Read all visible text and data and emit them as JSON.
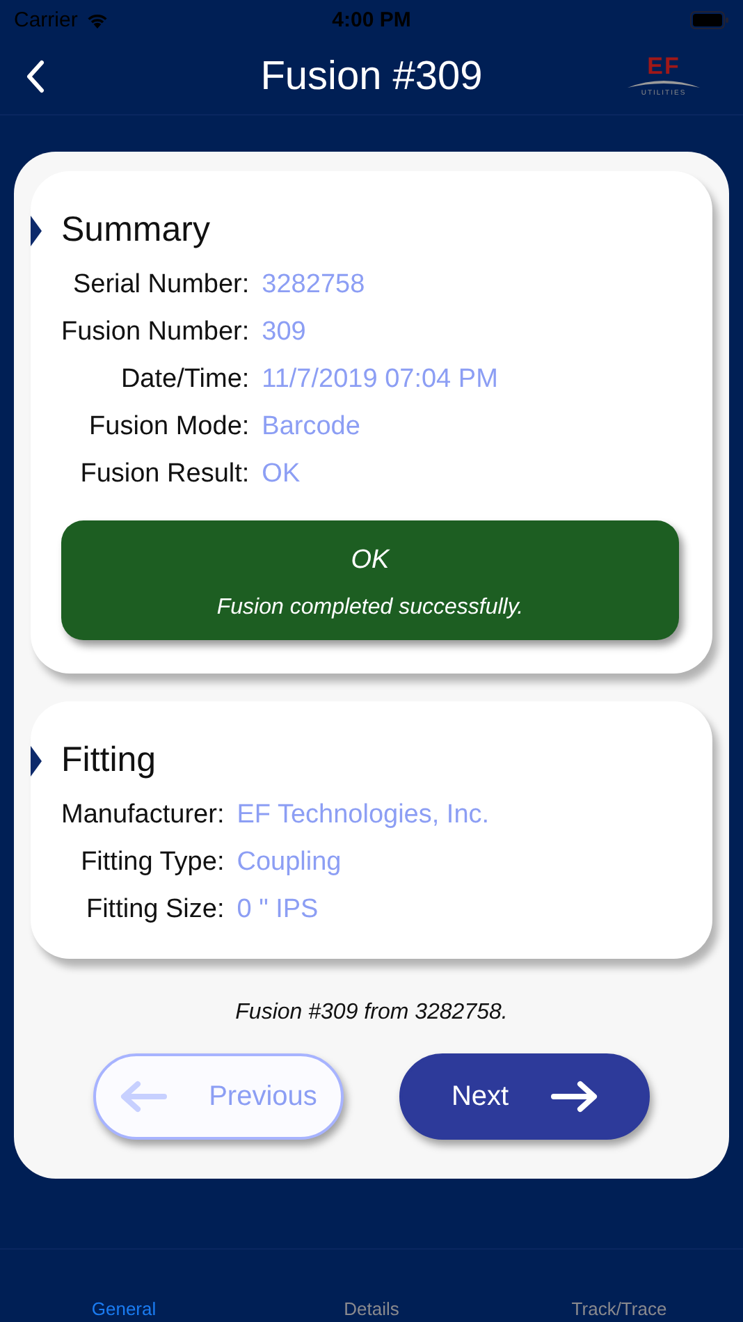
{
  "status_bar": {
    "carrier": "Carrier",
    "time": "4:00 PM"
  },
  "nav": {
    "title": "Fusion #309",
    "logo": {
      "letters": "EF",
      "tagline": "UTILITIES"
    }
  },
  "sections": [
    {
      "title": "Summary",
      "fields": [
        {
          "label": "Serial Number:",
          "value": "3282758"
        },
        {
          "label": "Fusion Number:",
          "value": "309"
        },
        {
          "label": "Date/Time:",
          "value": "11/7/2019 07:04 PM"
        },
        {
          "label": "Fusion Mode:",
          "value": "Barcode"
        },
        {
          "label": "Fusion Result:",
          "value": "OK"
        }
      ],
      "result": {
        "color": "#1d5e22",
        "title": "OK",
        "message": "Fusion completed successfully."
      }
    },
    {
      "title": "Fitting",
      "fields": [
        {
          "label": "Manufacturer:",
          "value": "EF Technologies, Inc."
        },
        {
          "label": "Fitting Type:",
          "value": "Coupling"
        },
        {
          "label": "Fitting Size:",
          "value": "0 \" IPS"
        }
      ]
    }
  ],
  "footer_note": "Fusion #309 from 3282758.",
  "buttons": [
    {
      "kind": "previous",
      "label": "Previous",
      "disabled": true
    },
    {
      "kind": "next",
      "label": "Next",
      "disabled": false
    }
  ],
  "tabs": [
    {
      "label": "General",
      "selected": true
    },
    {
      "label": "Details",
      "selected": false
    },
    {
      "label": "Track/Trace",
      "selected": false
    }
  ]
}
